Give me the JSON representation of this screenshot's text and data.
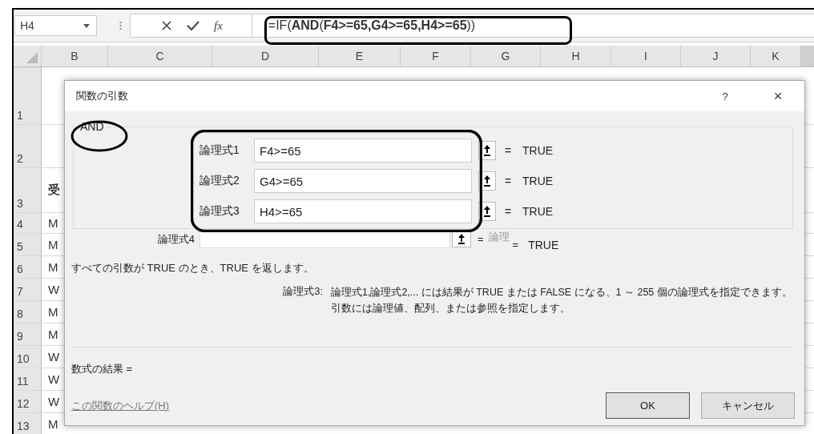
{
  "name_box": {
    "value": "H4"
  },
  "formula_bar": {
    "function_button": "fx",
    "formula": "=IF(**AND**(**F4>=65,G4>=65,H4>=65**))"
  },
  "columns": [
    "B",
    "C",
    "D",
    "E",
    "F",
    "G",
    "H",
    "I",
    "J",
    "K"
  ],
  "rows": [
    {
      "number": "1",
      "column_b": ""
    },
    {
      "number": "2",
      "column_b": ""
    },
    {
      "number": "3",
      "column_b": "受"
    },
    {
      "number": "4",
      "column_b": "M"
    },
    {
      "number": "5",
      "column_b": "M"
    },
    {
      "number": "6",
      "column_b": "M"
    },
    {
      "number": "7",
      "column_b": "W"
    },
    {
      "number": "8",
      "column_b": "M"
    },
    {
      "number": "9",
      "column_b": "M"
    },
    {
      "number": "10",
      "column_b": "W"
    },
    {
      "number": "11",
      "column_b": "W"
    },
    {
      "number": "12",
      "column_b": "W"
    },
    {
      "number": "13",
      "column_b": "M"
    }
  ],
  "dialog": {
    "title": "関数の引数",
    "help": "?",
    "close": "×",
    "function_name": "AND",
    "arguments": [
      {
        "label": "論理式1",
        "value": "F4>=65",
        "equals": "=",
        "result": "TRUE"
      },
      {
        "label": "論理式2",
        "value": "G4>=65",
        "equals": "=",
        "result": "TRUE"
      },
      {
        "label": "論理式3",
        "value": "H4>=65",
        "equals": "=",
        "result": "TRUE"
      }
    ],
    "extra_argument": {
      "label": "論理式4",
      "equals": "=",
      "placeholder": "論理",
      "result_equals": "=",
      "result": "TRUE"
    },
    "description": "すべての引数が TRUE のとき、TRUE を返します。",
    "argument_help": {
      "label": "論理式3:",
      "text": "論理式1,論理式2,... には結果が TRUE または FALSE になる、1 ～ 255 個の論理式を指定できます。引数には論理値、配列、または参照を指定します。"
    },
    "result_label": "数式の結果 =",
    "help_link": "この関数のヘルプ(H)",
    "buttons": [
      "OK",
      "キャンセル"
    ]
  }
}
